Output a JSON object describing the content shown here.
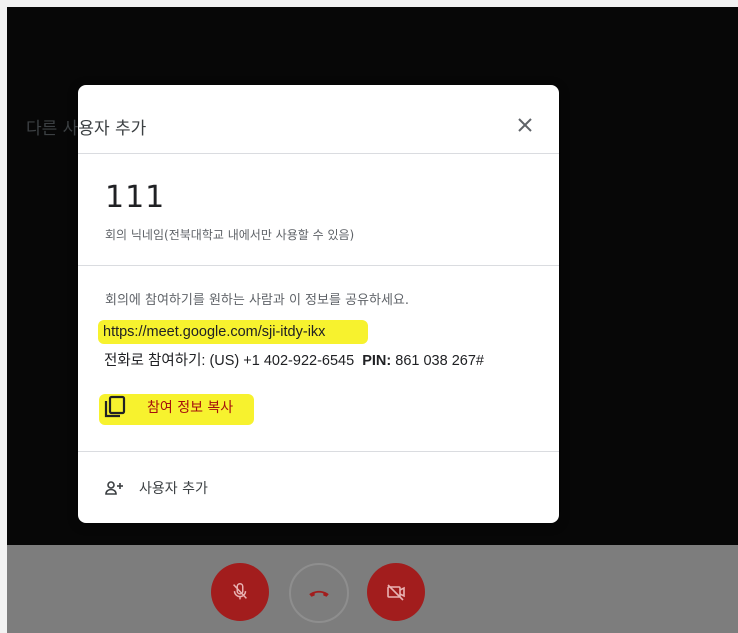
{
  "dialog": {
    "title": "다른 사용자 추가",
    "close_icon": "close-icon",
    "meeting_name": "111",
    "meeting_subtitle": "회의 닉네임(전북대학교 내에서만 사용할 수 있음)",
    "share_text": "회의에 참여하기를 원하는 사람과 이 정보를 공유하세요.",
    "meeting_link": "https://meet.google.com/sji-itdy-ikx",
    "phone_prefix": "전화로 참여하기: (US) +1 402-922-6545",
    "pin_label": "PIN:",
    "pin_value": "861 038 267#",
    "copy_label": "참여 정보 복사",
    "copy_icon": "copy-icon",
    "add_user_label": "사용자 추가",
    "add_user_icon": "person-add-icon"
  },
  "controls": {
    "mic_icon": "mic-off-icon",
    "hangup_icon": "hang-up-icon",
    "camera_icon": "camera-off-icon"
  },
  "colors": {
    "highlight": "#f7f22e",
    "accent_red": "#a21d1d",
    "copy_text": "#a50e0e"
  }
}
